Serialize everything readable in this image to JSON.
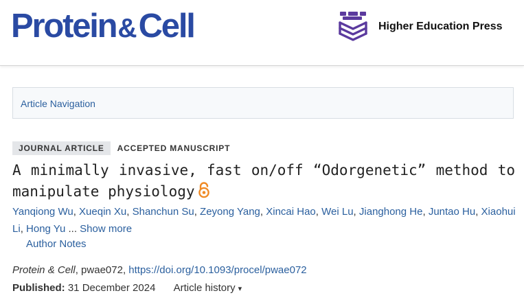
{
  "header": {
    "journal_name_part1": "Protein",
    "journal_name_amp": "&",
    "journal_name_part2": "Cell",
    "publisher_name": "Higher Education Press",
    "publisher_icon": "hep-logo-icon"
  },
  "article_nav": {
    "label": "Article Navigation"
  },
  "tags": {
    "type": "JOURNAL ARTICLE",
    "status": "ACCEPTED MANUSCRIPT"
  },
  "article": {
    "title": "A minimally invasive, fast on/off “Odorgenetic” method to manipulate physiology",
    "open_access_icon": "open-access-icon",
    "authors": [
      "Yanqiong Wu",
      "Xueqin Xu",
      "Shanchun Su",
      "Zeyong Yang",
      "Xincai Hao",
      "Wei Lu",
      "Jianghong He",
      "Juntao Hu",
      "Xiaohui Li",
      "Hong Yu"
    ],
    "ellipsis": "...",
    "show_more": "Show more",
    "author_notes": "Author Notes",
    "citation_journal": "Protein & Cell",
    "citation_id": ", pwae072, ",
    "doi": "https://doi.org/10.1093/procel/pwae072",
    "published_label": "Published:",
    "published_date": "31 December 2024",
    "article_history": "Article history",
    "history_caret": "▾"
  },
  "colors": {
    "brand": "#2a4aa3",
    "link": "#2a5f9e",
    "publisher_icon": "#5b3a9e"
  }
}
